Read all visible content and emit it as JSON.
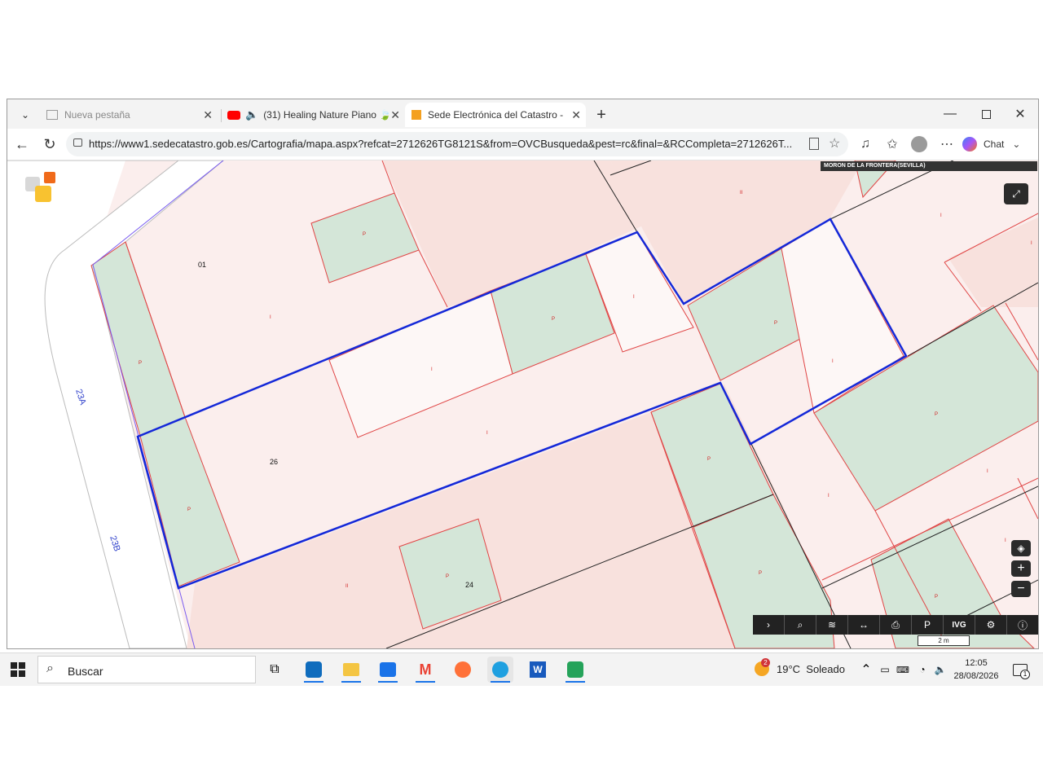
{
  "tabs": [
    {
      "title": "Nueva pestaña"
    },
    {
      "title": "(31) Healing Nature Piano 🍃"
    },
    {
      "title": "Sede Electrónica del Catastro - Fo"
    }
  ],
  "address": {
    "url": "https://www1.sedecatastro.gob.es/Cartografia/mapa.aspx?refcat=2712626TG8121S&from=OVCBusqueda&pest=rc&final=&RCCompleta=2712626T..."
  },
  "toolbar": {
    "chat_label": "Chat"
  },
  "map": {
    "municipality": "MORON DE LA FRONTERA(SEVILLA)",
    "parcel_numbers": [
      "01",
      "26",
      "24"
    ],
    "street_labels": [
      "23A",
      "23B"
    ],
    "parcel_codes": [
      "P",
      "I",
      "II"
    ],
    "scale_label": "2 m",
    "tools": [
      "chevron-right",
      "search",
      "layers",
      "measure",
      "print",
      "parking",
      "IVG",
      "objects",
      "info"
    ],
    "ivg_label": "IVG"
  },
  "taskbar": {
    "search_placeholder": "Buscar",
    "weather": "19°C  Soleado",
    "weather_badge": "2",
    "time": "12:05",
    "date": "28/08/2026",
    "notif_count": "1"
  }
}
